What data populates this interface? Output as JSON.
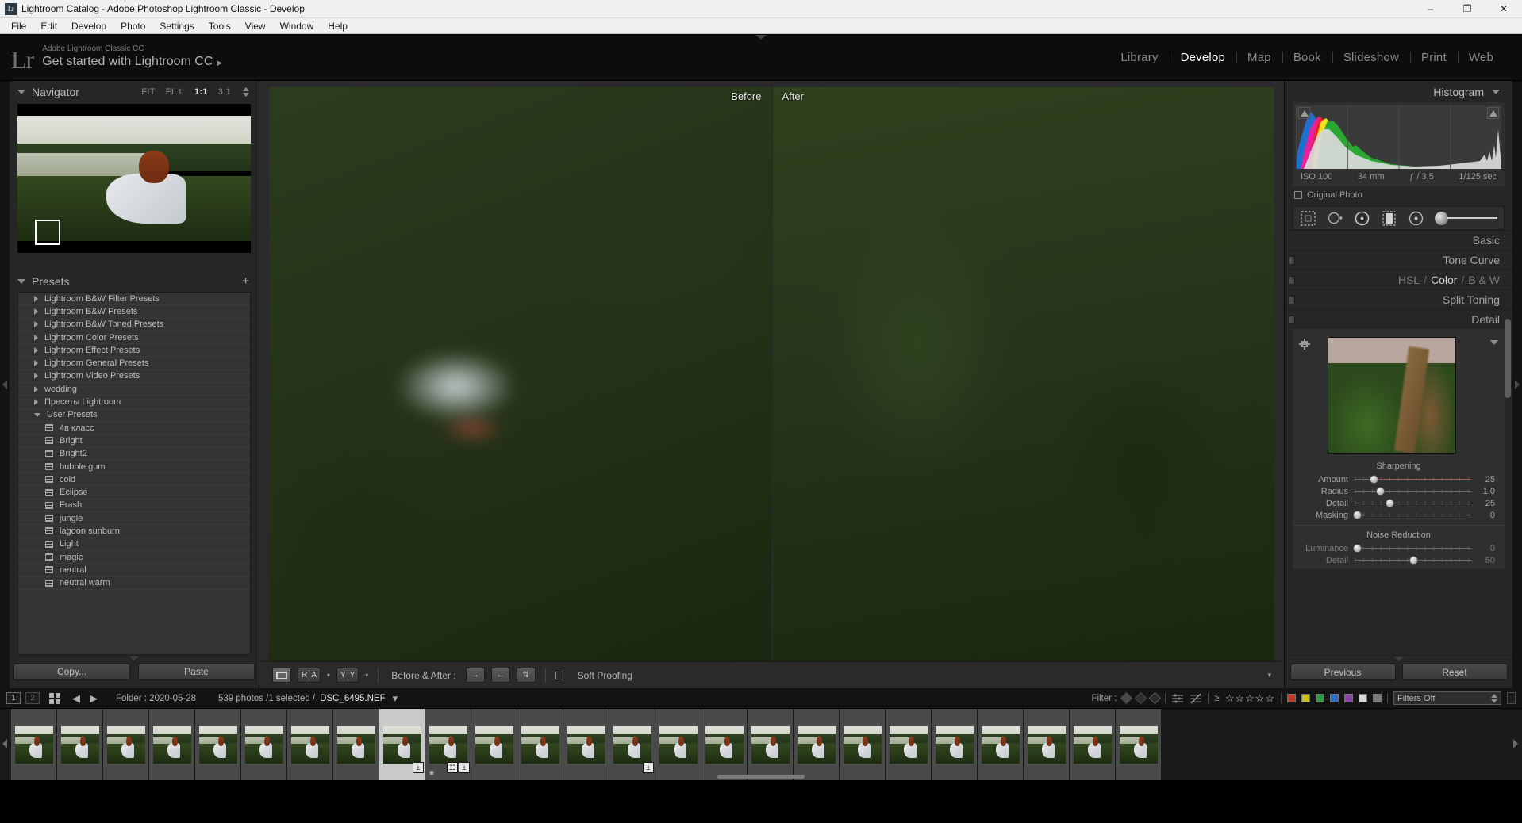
{
  "window": {
    "title": "Lightroom Catalog - Adobe Photoshop Lightroom Classic - Develop",
    "app_icon": "Lr",
    "minimize": "–",
    "maximize": "❐",
    "close": "✕"
  },
  "menubar": [
    "File",
    "Edit",
    "Develop",
    "Photo",
    "Settings",
    "Tools",
    "View",
    "Window",
    "Help"
  ],
  "identity": {
    "logo": "Lr",
    "sub": "Adobe Lightroom Classic CC",
    "main": "Get started with Lightroom CC",
    "arrow": "▶"
  },
  "modules": [
    {
      "label": "Library",
      "active": false
    },
    {
      "label": "Develop",
      "active": true
    },
    {
      "label": "Map",
      "active": false
    },
    {
      "label": "Book",
      "active": false
    },
    {
      "label": "Slideshow",
      "active": false
    },
    {
      "label": "Print",
      "active": false
    },
    {
      "label": "Web",
      "active": false
    }
  ],
  "navigator": {
    "title": "Navigator",
    "zoom_levels": [
      {
        "label": "FIT",
        "active": false
      },
      {
        "label": "FILL",
        "active": false
      },
      {
        "label": "1:1",
        "active": true
      },
      {
        "label": "3:1",
        "active": false
      }
    ]
  },
  "presets": {
    "title": "Presets",
    "add_label": "+",
    "groups": [
      {
        "label": "Lightroom B&W Filter Presets",
        "expanded": false
      },
      {
        "label": "Lightroom B&W Presets",
        "expanded": false
      },
      {
        "label": "Lightroom B&W Toned Presets",
        "expanded": false
      },
      {
        "label": "Lightroom Color Presets",
        "expanded": false
      },
      {
        "label": "Lightroom Effect Presets",
        "expanded": false
      },
      {
        "label": "Lightroom General Presets",
        "expanded": false
      },
      {
        "label": "Lightroom Video Presets",
        "expanded": false
      },
      {
        "label": "wedding",
        "expanded": false
      },
      {
        "label": "Пресеты Lightroom",
        "expanded": false
      },
      {
        "label": "User Presets",
        "expanded": true
      }
    ],
    "user_presets": [
      "4в класс",
      "Bright",
      "Bright2",
      "bubble gum",
      "cold",
      "Eclipse",
      "Frash",
      "jungle",
      "lagoon sunburn",
      "Light",
      "magic",
      "neutral",
      "neutral warm"
    ]
  },
  "left_buttons": {
    "copy": "Copy...",
    "paste": "Paste"
  },
  "viewer": {
    "before_label": "Before",
    "after_label": "After"
  },
  "toolbar": {
    "loupe_icon": "loupe-view",
    "ra_left": "R",
    "ra_right": "A",
    "yy_left": "Y",
    "yy_right": "Y",
    "caret": "▾",
    "before_after_label": "Before & After :",
    "copy_after_to_before": "→",
    "copy_before_to_after": "←",
    "swap": "⇅",
    "soft_proofing": "Soft Proofing",
    "right_caret": "▾"
  },
  "histogram": {
    "title": "Histogram",
    "iso": "ISO 100",
    "focal": "34 mm",
    "aperture": "ƒ / 3,5",
    "shutter": "1/125 sec",
    "original_photo": "Original Photo"
  },
  "panels": [
    {
      "label": "Basic",
      "expanded": false
    },
    {
      "label": "Tone Curve",
      "expanded": false
    },
    {
      "label": "HSL / Color / B & W",
      "expanded": false
    },
    {
      "label": "Split Toning",
      "expanded": false
    },
    {
      "label": "Detail",
      "expanded": true
    }
  ],
  "hsl": {
    "hsl": "HSL",
    "color": "Color",
    "bw": "B & W",
    "sep": "/"
  },
  "detail": {
    "title": "Detail",
    "sharpening_title": "Sharpening",
    "noise_title": "Noise Reduction",
    "sharpening": [
      {
        "name": "Amount",
        "value": "25",
        "pos": 16,
        "accent": true
      },
      {
        "name": "Radius",
        "value": "1,0",
        "pos": 22,
        "accent": false
      },
      {
        "name": "Detail",
        "value": "25",
        "pos": 30,
        "accent": false
      },
      {
        "name": "Masking",
        "value": "0",
        "pos": 2,
        "accent": false
      }
    ],
    "noise": [
      {
        "name": "Luminance",
        "value": "0",
        "pos": 2,
        "dim": true
      },
      {
        "name": "Detail",
        "value": "50",
        "pos": 50,
        "dim": true
      }
    ]
  },
  "right_buttons": {
    "previous": "Previous",
    "reset": "Reset"
  },
  "filmstrip_bar": {
    "display1": "1",
    "display2": "2",
    "grid_icon": "grid-view-icon",
    "back": "◀",
    "forward": "▶",
    "folder": "Folder : 2020-05-28",
    "count": "539 photos /1 selected /",
    "filename": "DSC_6495.NEF",
    "caret": "▾",
    "filter_label": "Filter :",
    "star_count": 5,
    "star_glyph": "★",
    "gte": "≥",
    "color_swatches": [
      "#c0392b",
      "#c9c316",
      "#2f9e44",
      "#2f6fc9",
      "#8e44ad",
      "#d8d8d8",
      "#7a7a7a"
    ],
    "filters_off": "Filters Off"
  },
  "filmstrip": {
    "thumb_count": 25,
    "selected_index": 8,
    "badges": [
      {
        "index": 8,
        "glyph": "±"
      },
      {
        "index": 9,
        "glyph": "±"
      },
      {
        "index": 9,
        "glyph2": "☷"
      },
      {
        "index": 13,
        "glyph": "±"
      }
    ]
  },
  "colors": {
    "panel_bg": "#262626",
    "panel_inner": "#333333",
    "accent_red": "#b0574f",
    "text": "#b4b4b4",
    "text_dim": "#7a7a7a",
    "viewer_bg": "#2a2a2a"
  }
}
